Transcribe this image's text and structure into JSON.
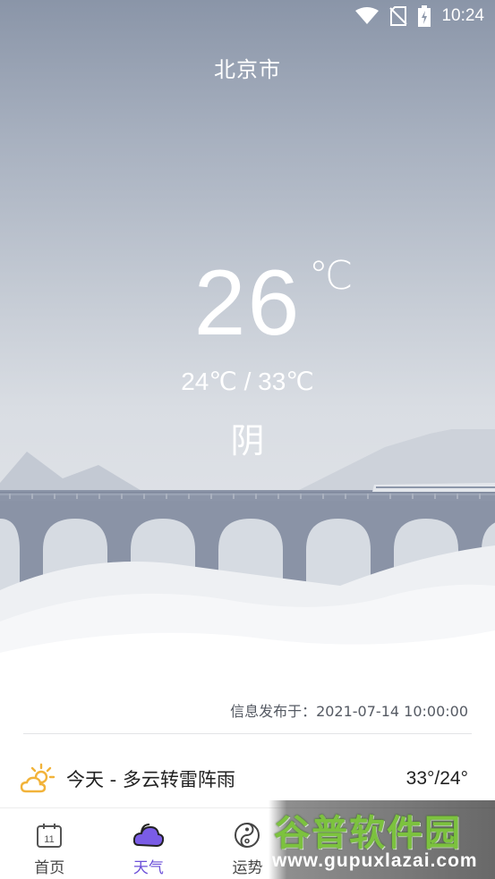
{
  "status_bar": {
    "time": "10:24",
    "icons": [
      "wifi-icon",
      "no-sim-icon",
      "battery-charging-icon"
    ]
  },
  "weather": {
    "city": "北京市",
    "temperature": "26",
    "temperature_unit": "℃",
    "range": "24℃ / 33℃",
    "condition": "阴"
  },
  "publish": {
    "label": "信息发布于：2021-07-14 10:00:00"
  },
  "forecast": {
    "icon": "partly-cloudy-sun-icon",
    "text": "今天 - 多云转雷阵雨",
    "temps": "33°/24°"
  },
  "tabbar": {
    "active": "天气",
    "tabs": [
      {
        "label": "首页",
        "icon": "calendar-icon"
      },
      {
        "label": "天气",
        "icon": "weather-cloud-icon"
      },
      {
        "label": "运势",
        "icon": "yin-yang-icon"
      }
    ]
  },
  "watermark": {
    "title": "谷普软件园",
    "url": "www.gupuxlazai.com"
  },
  "colors": {
    "accent": "#6b4fd8",
    "sky_top": "#8a95a8",
    "bridge": "#8c95a8"
  }
}
